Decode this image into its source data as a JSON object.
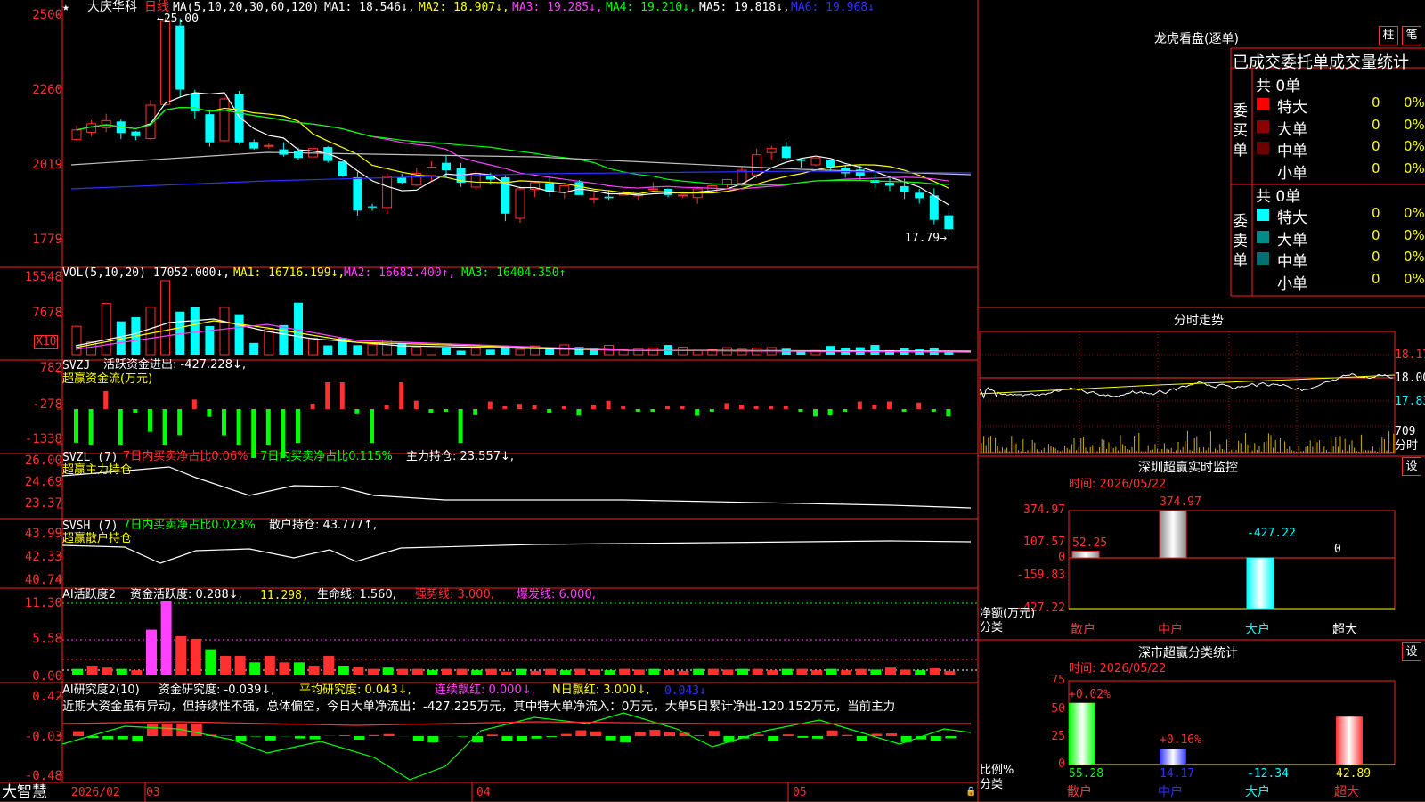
{
  "stock": {
    "name": "大庆华科",
    "period": "日线",
    "mark": "★"
  },
  "main": {
    "ma_label": "MA(5,10,20,30,60,120)",
    "ma1": "MA1: 18.546↓,",
    "ma2": "MA2: 18.907↓,",
    "ma3": "MA3: 19.285↓,",
    "ma4": "MA4: 19.210↓,",
    "ma5": "MA5: 19.818↓,",
    "ma6": "MA6: 19.968↓",
    "high_marker": "←25.00",
    "low_marker": "17.79→",
    "y_ticks": [
      "2500",
      "2260",
      "2019",
      "1779"
    ]
  },
  "vol": {
    "label": "VOL(5,10,20)",
    "value": "17052.000↓,",
    "ma1": "MA1: 16716.199↓,",
    "ma2": "MA2: 16682.400↑,",
    "ma3": "MA3: 16404.350↑",
    "y_ticks": [
      "15548",
      "7678"
    ],
    "unit": "X10"
  },
  "svzj": {
    "label": "SVZJ",
    "title": "活跃资金进出: -427.228↓,",
    "subtitle": "超赢资金流(万元)",
    "y_ticks": [
      "782",
      "-278",
      "-1338"
    ]
  },
  "svzl": {
    "label": "SVZL (7)",
    "a": "7日内买卖净占比0.06%",
    "b": "7日内买卖净占比0.115%",
    "c": "主力持仓: 23.557↓,",
    "subtitle": "超赢主力持仓",
    "y_ticks": [
      "26.00",
      "24.69",
      "23.37"
    ]
  },
  "svsh": {
    "label": "SVSH (7)",
    "a": "7日内买卖净占比0.023%",
    "c": "散户持仓: 43.777↑,",
    "subtitle": "超赢散户持仓",
    "y_ticks": [
      "43.99",
      "42.33",
      "40.74"
    ]
  },
  "ai1": {
    "label": "AI活跃度2",
    "a": "资金活跃度: 0.288↓,",
    "b": "11.298,",
    "c": "生命线: 1.560,",
    "d": "强势线: 3.000,",
    "e": "爆发线: 6.000,",
    "y_ticks": [
      "11.30",
      "5.58",
      "0.00"
    ]
  },
  "ai2": {
    "label": "AI研究度2(10)",
    "a": "资金研究度: -0.039↓,",
    "b": "平均研究度: 0.043↓,",
    "c": "连续飘红: 0.000↓,",
    "d": "N日飘红: 3.000↓,",
    "e": "0.043↓",
    "comment": "近期大资金虽有异动，但持续性不强，总体偏空，今日大单净流出：-427.225万元，其中特大单净流入：0万元，大单5日累计净出-120.152万元，当前主力",
    "y_ticks": [
      "0.42",
      "-0.03",
      "-0.48"
    ]
  },
  "footer": {
    "brand": "大智慧",
    "date1": "2026/02",
    "m1": "03",
    "m2": "04",
    "m3": "05"
  },
  "right": {
    "lhkp": "龙虎看盘(逐单)",
    "btn1": "柱",
    "btn2": "笔",
    "header": "已成交委托单成交量统计",
    "buy": {
      "side": [
        "委",
        "买",
        "单"
      ],
      "total": "共 0单",
      "rows": [
        {
          "name": "特大",
          "v": "0",
          "p": "0%",
          "color": "#ff0000"
        },
        {
          "name": "大单",
          "v": "0",
          "p": "0%",
          "color": "#8b0000"
        },
        {
          "name": "中单",
          "v": "0",
          "p": "0%",
          "color": "#6b0000"
        },
        {
          "name": "小单",
          "v": "0",
          "p": "0%",
          "color": ""
        }
      ]
    },
    "sell": {
      "side": [
        "委",
        "卖",
        "单"
      ],
      "total": "共 0单",
      "rows": [
        {
          "name": "特大",
          "v": "0",
          "p": "0%",
          "color": "#00ffff"
        },
        {
          "name": "大单",
          "v": "0",
          "p": "0%",
          "color": "#008b8b"
        },
        {
          "name": "中单",
          "v": "0",
          "p": "0%",
          "color": "#007070"
        },
        {
          "name": "小单",
          "v": "0",
          "p": "0%",
          "color": ""
        }
      ]
    },
    "fenshi": {
      "title": "分时走势",
      "p1": "18.17",
      "p2": "18.00",
      "p3": "17.83",
      "vol": "709",
      "unit": "分时"
    },
    "monitor": {
      "title": "深圳超赢实时监控",
      "set": "设",
      "time": "时间: 2026/05/22",
      "ticks": [
        "374.97",
        "107.57",
        "0",
        "-159.83",
        "-427.22"
      ],
      "ylabel": "净额(万元)",
      "xlabel": "分类",
      "bars": [
        {
          "cat": "散户",
          "val": "52.25"
        },
        {
          "cat": "中户",
          "val": "374.97"
        },
        {
          "cat": "大户",
          "val": "-427.22"
        },
        {
          "cat": "超大",
          "val": "0"
        }
      ]
    },
    "classify": {
      "title": "深市超赢分类统计",
      "set": "设",
      "time": "时间: 2026/05/22",
      "ticks": [
        "75",
        "50",
        "25",
        "0"
      ],
      "ylabel": "比例%",
      "xlabel": "分类",
      "bars": [
        {
          "cat": "散户",
          "top": "+0.02%",
          "bottom": "55.28",
          "value": 55.28
        },
        {
          "cat": "中户",
          "top": "+0.16%",
          "bottom": "14.17",
          "value": 14.17
        },
        {
          "cat": "大户",
          "top": "",
          "bottom": "-12.34",
          "value": -12.34
        },
        {
          "cat": "超大",
          "top": "",
          "bottom": "42.89",
          "value": 42.89
        }
      ]
    }
  }
}
